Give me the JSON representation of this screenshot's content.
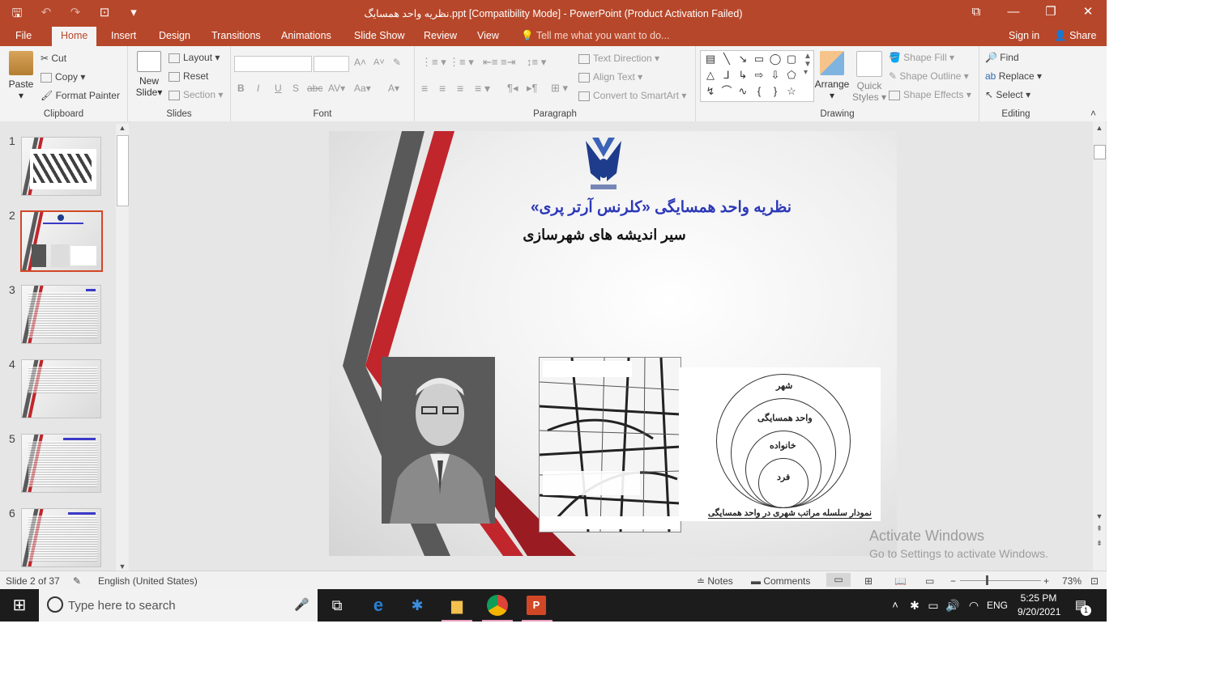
{
  "window": {
    "title": "نظریه واحد همسایگ.ppt [Compatibility Mode] - PowerPoint (Product Activation Failed)",
    "controls": [
      "⧉",
      "—",
      "❐",
      "✕"
    ]
  },
  "qat": {
    "save": "🖫",
    "undo": "↶",
    "redo": "↷",
    "present": "⊡",
    "customize": "▾"
  },
  "tabs": [
    "File",
    "Home",
    "Insert",
    "Design",
    "Transitions",
    "Animations",
    "Slide Show",
    "Review",
    "View"
  ],
  "active_tab": "Home",
  "tell_me": "Tell me what you want to do...",
  "sign_in": "Sign in",
  "share": "Share",
  "ribbon": {
    "clipboard": {
      "label": "Clipboard",
      "paste": "Paste",
      "cut": "Cut",
      "copy": "Copy",
      "format_painter": "Format Painter"
    },
    "slides": {
      "label": "Slides",
      "new_slide": "New Slide",
      "layout": "Layout",
      "reset": "Reset",
      "section": "Section"
    },
    "font": {
      "label": "Font",
      "bold": "B",
      "italic": "I",
      "underline": "U",
      "shadow": "S",
      "strike": "abc",
      "spacing": "AV",
      "case": "Aa",
      "color": "A",
      "grow": "A",
      "shrink": "A"
    },
    "paragraph": {
      "label": "Paragraph",
      "text_direction": "Text Direction",
      "align_text": "Align Text",
      "smartart": "Convert to SmartArt"
    },
    "drawing": {
      "label": "Drawing",
      "arrange": "Arrange",
      "quick_styles": "Quick Styles",
      "shape_fill": "Shape Fill",
      "shape_outline": "Shape Outline",
      "shape_effects": "Shape Effects"
    },
    "editing": {
      "label": "Editing",
      "find": "Find",
      "replace": "Replace",
      "select": "Select"
    }
  },
  "thumbnails": [
    "1",
    "2",
    "3",
    "4",
    "5",
    "6"
  ],
  "selected_slide": 2,
  "slide": {
    "title": "نظریه واحد همسایگی «کلرنس آرتر پری»",
    "subtitle": "سیر اندیشه های شهرسازی",
    "diagram_labels": [
      "شهر",
      "واحد همسایگی",
      "خانواده",
      "فرد"
    ],
    "diagram_caption": "نمودار سلسله مراتب شهری در واحد همسایگی"
  },
  "watermark": {
    "line1": "Activate Windows",
    "line2": "Go to Settings to activate Windows."
  },
  "status": {
    "slide_info": "Slide 2 of 37",
    "language": "English (United States)",
    "notes": "Notes",
    "comments": "Comments",
    "zoom": "73%"
  },
  "taskbar": {
    "search_placeholder": "Type here to search",
    "lang": "ENG",
    "time": "5:25 PM",
    "date": "9/20/2021",
    "notifications": "1"
  }
}
